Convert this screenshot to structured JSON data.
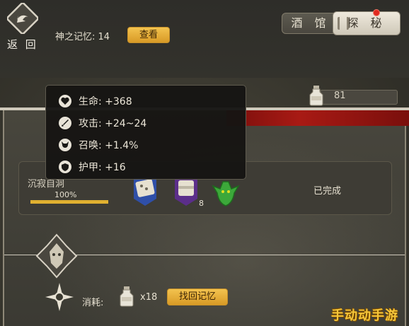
{
  "header": {
    "back_label": "返 回",
    "memory_label": "神之记忆: 14",
    "view_button": "查看",
    "tabs": [
      {
        "label": "酒 馆",
        "active": false
      },
      {
        "label": "探 秘",
        "active": true,
        "has_notification": true
      }
    ]
  },
  "resources": {
    "bottles": "81"
  },
  "level": {
    "name": "沉寂自洞",
    "progress_label": "100%",
    "progress": 1.0,
    "card_count": "8",
    "status": "已完成"
  },
  "tooltip": {
    "stats": [
      {
        "label": "生命: +368",
        "icon": "heart-icon"
      },
      {
        "label": "攻击: +24~24",
        "icon": "sword-icon"
      },
      {
        "label": "召唤: +1.4%",
        "icon": "demon-head-icon"
      },
      {
        "label": "护甲: +16",
        "icon": "shield-icon"
      }
    ]
  },
  "consume": {
    "label": "消耗:",
    "count": "x18",
    "button": "找回记忆"
  },
  "watermark": "手动动手游",
  "colors": {
    "gold_button": "#e8ae3a",
    "red_band": "#a81a14",
    "progress_fill": "#e0b030",
    "notification": "#e02a20"
  }
}
